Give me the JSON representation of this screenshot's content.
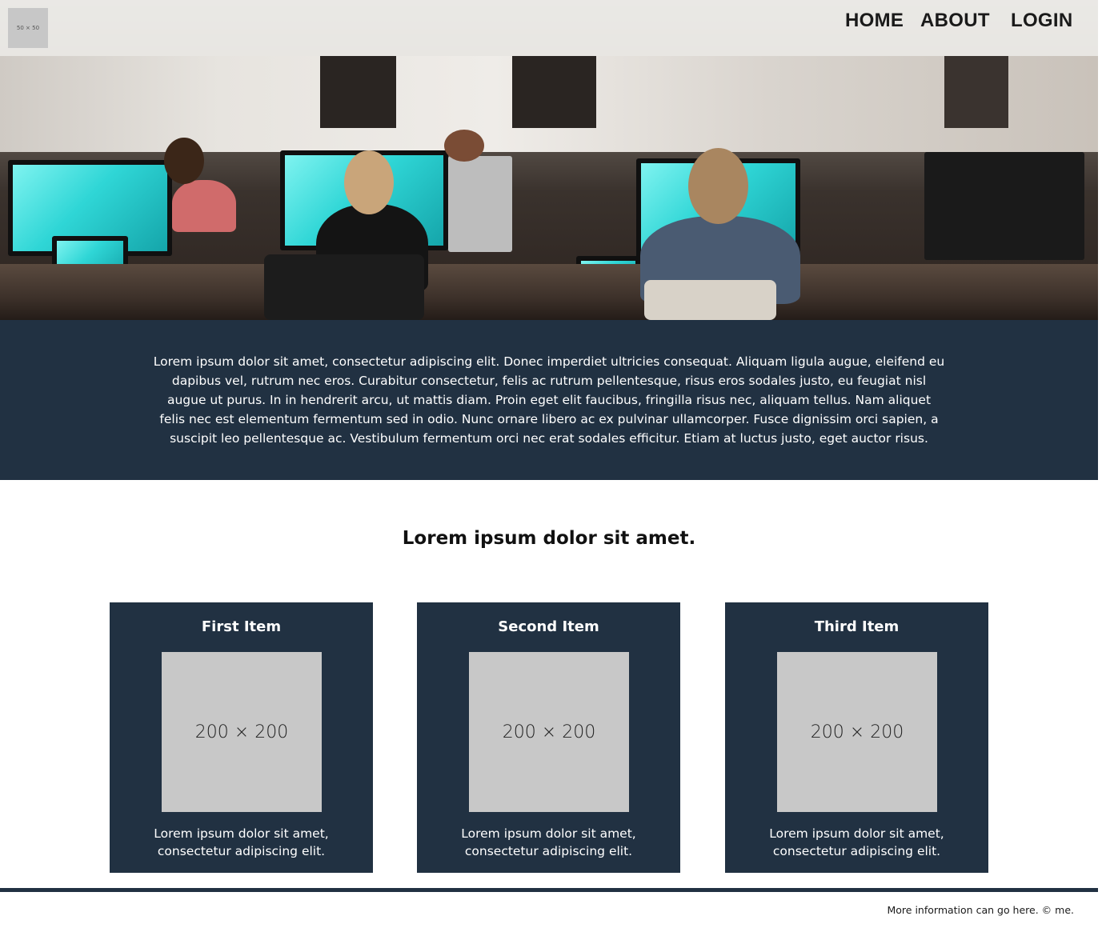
{
  "header": {
    "logo_text": "50 × 50",
    "nav": [
      {
        "label": "HOME"
      },
      {
        "label": "ABOUT"
      },
      {
        "label": "LOGIN"
      }
    ]
  },
  "intro": {
    "text": "Lorem ipsum dolor sit amet, consectetur adipiscing elit. Donec imperdiet ultricies consequat. Aliquam ligula augue, eleifend eu dapibus vel, rutrum nec eros. Curabitur consectetur, felis ac rutrum pellentesque, risus eros sodales justo, eu feugiat nisl augue ut purus. In in hendrerit arcu, ut mattis diam. Proin eget elit faucibus, fringilla risus nec, aliquam tellus. Nam aliquet felis nec est elementum fermentum sed in odio. Nunc ornare libero ac ex pulvinar ullamcorper. Fusce dignissim orci sapien, a suscipit leo pellentesque ac. Vestibulum fermentum orci nec erat sodales efficitur. Etiam at luctus justo, eget auctor risus."
  },
  "section": {
    "title": "Lorem ipsum dolor sit amet."
  },
  "cards": [
    {
      "title": "First Item",
      "image_text": "200 × 200",
      "description": "Lorem ipsum dolor sit amet, consectetur adipiscing elit."
    },
    {
      "title": "Second Item",
      "image_text": "200 × 200",
      "description": "Lorem ipsum dolor sit amet, consectetur adipiscing elit."
    },
    {
      "title": "Third Item",
      "image_text": "200 × 200",
      "description": "Lorem ipsum dolor sit amet, consectetur adipiscing elit."
    }
  ],
  "footer": {
    "text": "More information can go here. © me."
  },
  "colors": {
    "dark_band": "#213142",
    "placeholder_gray": "#c8c8c8",
    "navbar_bg": "#eceae7"
  }
}
